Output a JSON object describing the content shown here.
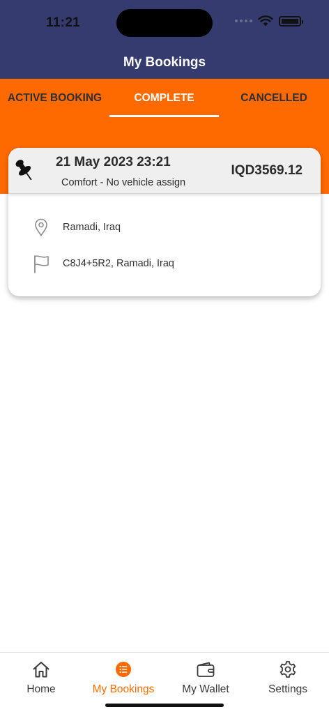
{
  "status_bar": {
    "time": "11:21"
  },
  "header": {
    "title": "My Bookings"
  },
  "tabs": [
    {
      "label": "ACTIVE BOOKING",
      "active": false
    },
    {
      "label": "COMPLETE",
      "active": true
    },
    {
      "label": "CANCELLED",
      "active": false
    }
  ],
  "booking": {
    "datetime": "21 May 2023 23:21",
    "vehicle": "Comfort - No vehicle assign",
    "price": "IQD3569.12",
    "pickup": "Ramadi, Iraq",
    "dropoff": "C8J4+5R2, Ramadi, Iraq"
  },
  "bottom_nav": [
    {
      "label": "Home",
      "icon": "home-icon"
    },
    {
      "label": "My Bookings",
      "icon": "list-icon",
      "active": true
    },
    {
      "label": "My Wallet",
      "icon": "wallet-icon"
    },
    {
      "label": "Settings",
      "icon": "gear-icon"
    }
  ],
  "colors": {
    "header": "#353b6e",
    "accent": "#ff6a00"
  }
}
